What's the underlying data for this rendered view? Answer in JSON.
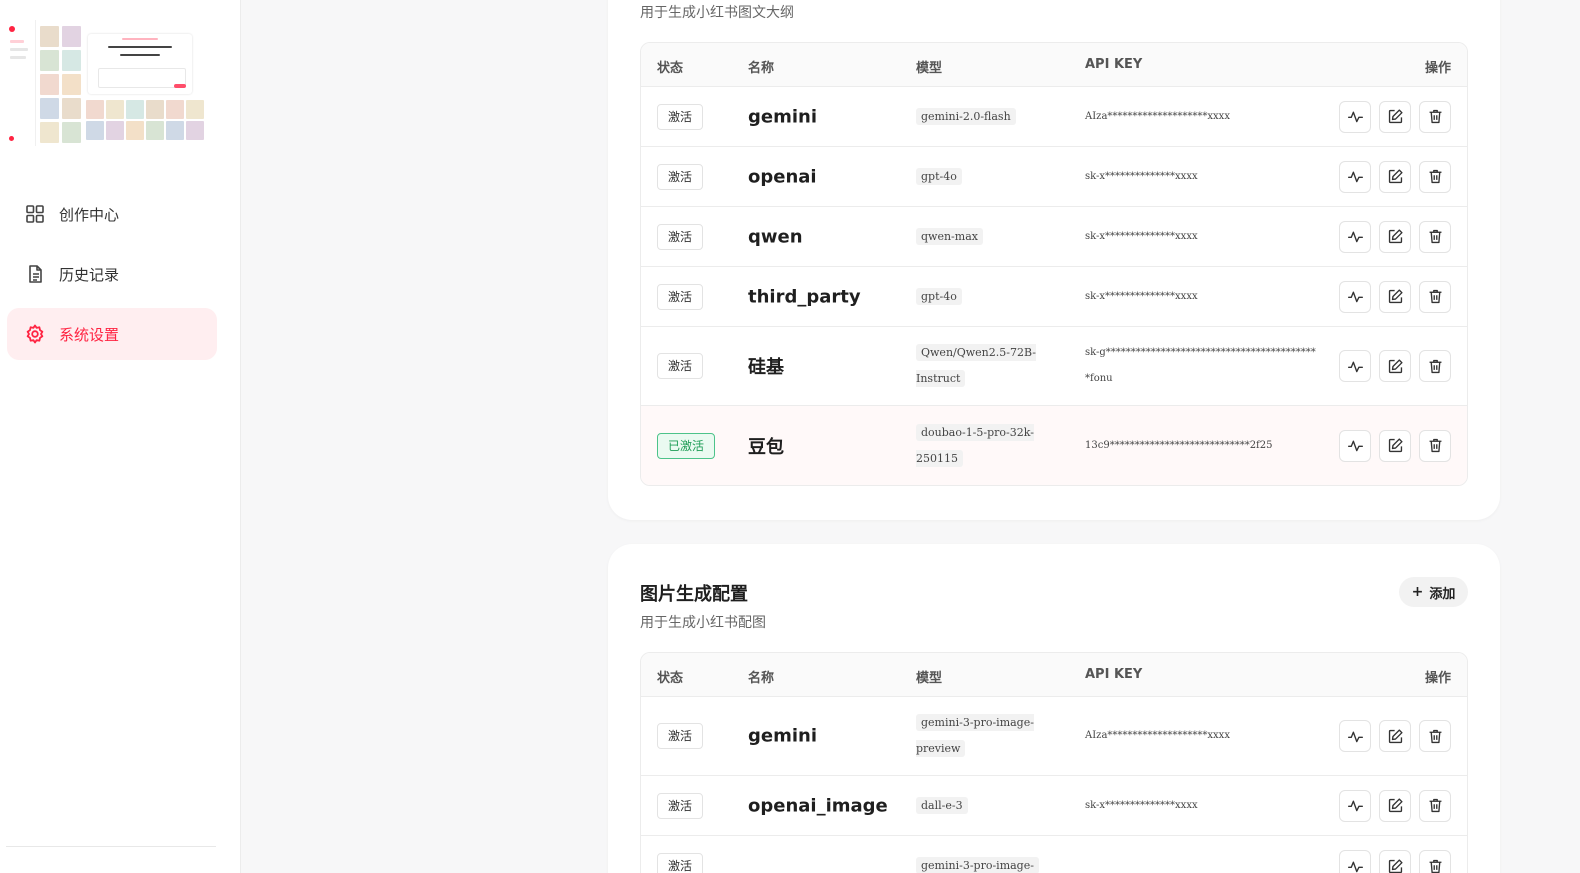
{
  "sidebar": {
    "items": [
      {
        "label": "创作中心",
        "icon": "grid-icon",
        "active": false
      },
      {
        "label": "历史记录",
        "icon": "document-icon",
        "active": false
      },
      {
        "label": "系统设置",
        "icon": "settings-icon",
        "active": true
      }
    ]
  },
  "text_card": {
    "subtitle": "用于生成小红书图文大纲",
    "headers": {
      "status": "状态",
      "name": "名称",
      "model": "模型",
      "api_key": "API KEY",
      "ops": "操作"
    },
    "rows": [
      {
        "status": "激活",
        "name": "gemini",
        "model": "gemini-2.0-flash",
        "key": "AIza********************xxxx",
        "active": false
      },
      {
        "status": "激活",
        "name": "openai",
        "model": "gpt-4o",
        "key": "sk-x**************xxxx",
        "active": false
      },
      {
        "status": "激活",
        "name": "qwen",
        "model": "qwen-max",
        "key": "sk-x**************xxxx",
        "active": false
      },
      {
        "status": "激活",
        "name": "third_party",
        "model": "gpt-4o",
        "key": "sk-x**************xxxx",
        "active": false
      },
      {
        "status": "激活",
        "name": "硅基",
        "model": "Qwen/Qwen2.5-72B-Instruct",
        "key": "sk-g*******************************************fonu",
        "active": false
      },
      {
        "status": "已激活",
        "name": "豆包",
        "model": "doubao-1-5-pro-32k-250115",
        "key": "13c9****************************2f25",
        "active": true
      }
    ]
  },
  "image_card": {
    "title": "图片生成配置",
    "subtitle": "用于生成小红书配图",
    "add_label": "添加",
    "headers": {
      "status": "状态",
      "name": "名称",
      "model": "模型",
      "api_key": "API KEY",
      "ops": "操作"
    },
    "rows": [
      {
        "status": "激活",
        "name": "gemini",
        "model": "gemini-3-pro-image-preview",
        "key": "AIza********************xxxx",
        "active": false
      },
      {
        "status": "激活",
        "name": "openai_image",
        "model": "dall-e-3",
        "key": "sk-x**************xxxx",
        "active": false
      },
      {
        "status": "激活",
        "name": "",
        "model": "gemini-3-pro-image-",
        "key": "",
        "active": false
      }
    ]
  },
  "colors": {
    "accent": "#ff2442",
    "active_green": "#1f9d57"
  }
}
